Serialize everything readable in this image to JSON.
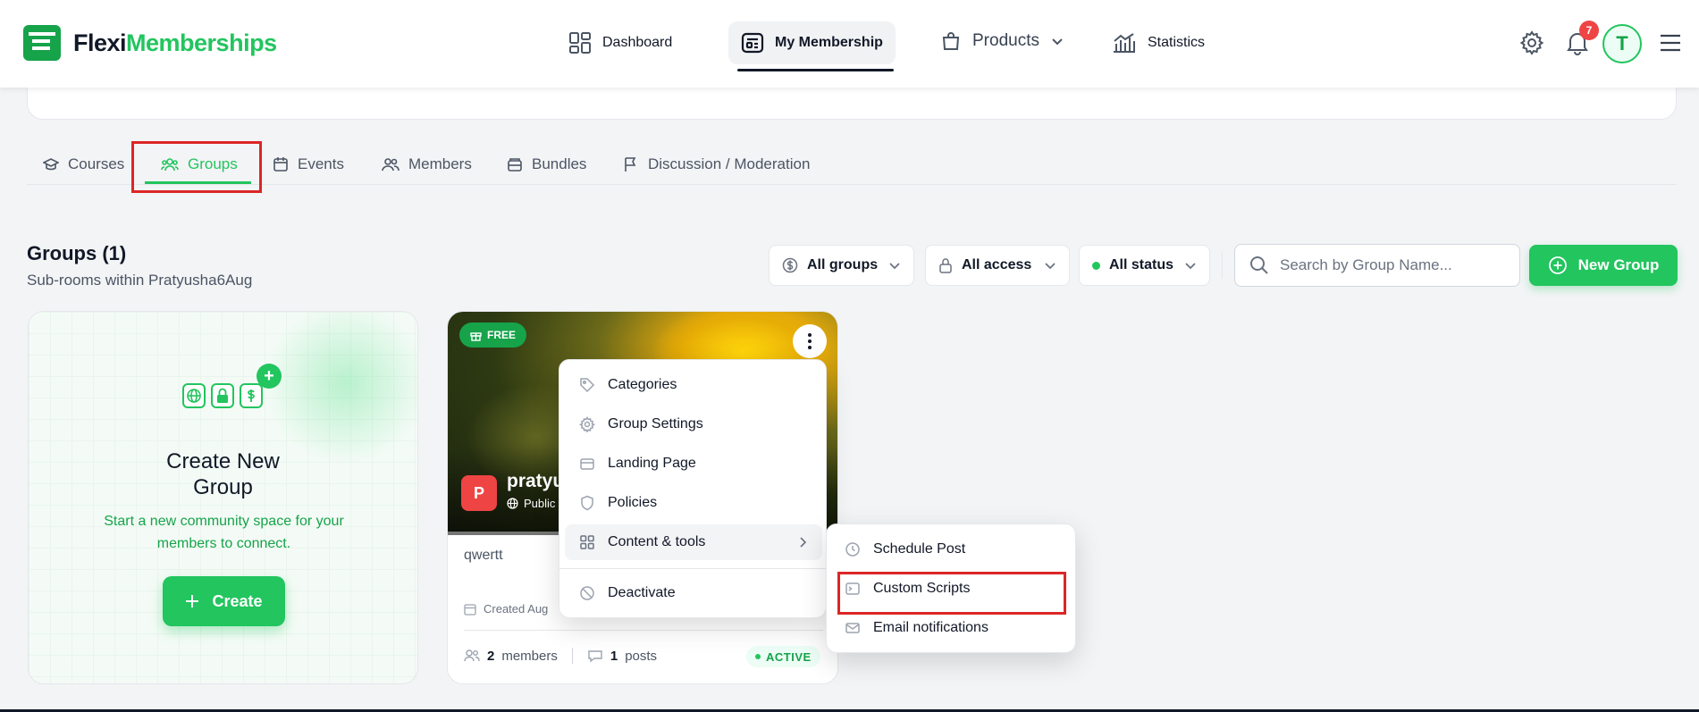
{
  "brand": {
    "name_part1": "Flexi",
    "name_part2": "Memberships",
    "accent": "#22c55e"
  },
  "nav": {
    "dashboard": "Dashboard",
    "my_membership": "My Membership",
    "products": "Products",
    "statistics": "Statistics"
  },
  "header": {
    "notification_count": "7",
    "avatar_initial": "T"
  },
  "tabs": {
    "courses": "Courses",
    "groups": "Groups",
    "events": "Events",
    "members": "Members",
    "bundles": "Bundles",
    "discussion": "Discussion / Moderation"
  },
  "groups_section": {
    "title": "Groups (1)",
    "subtitle": "Sub-rooms within Pratyusha6Aug",
    "filter_groups": "All groups",
    "filter_access": "All access",
    "filter_status": "All status",
    "search_placeholder": "Search by Group Name...",
    "new_group": "New Group"
  },
  "create_card": {
    "title": "Create New Group",
    "description": "Start a new community space for your members to connect.",
    "button": "Create"
  },
  "group_card": {
    "badge": "FREE",
    "avatar_letter": "P",
    "name": "pratyus",
    "visibility": "Public",
    "description": "qwertt",
    "created": "Created Aug",
    "members_count": "2",
    "members_label": "members",
    "posts_count": "1",
    "posts_label": "posts",
    "status": "ACTIVE"
  },
  "menu": {
    "categories": "Categories",
    "group_settings": "Group Settings",
    "landing_page": "Landing Page",
    "policies": "Policies",
    "content_tools": "Content & tools",
    "deactivate": "Deactivate"
  },
  "submenu": {
    "schedule_post": "Schedule Post",
    "custom_scripts": "Custom Scripts",
    "email_notifications": "Email notifications"
  }
}
